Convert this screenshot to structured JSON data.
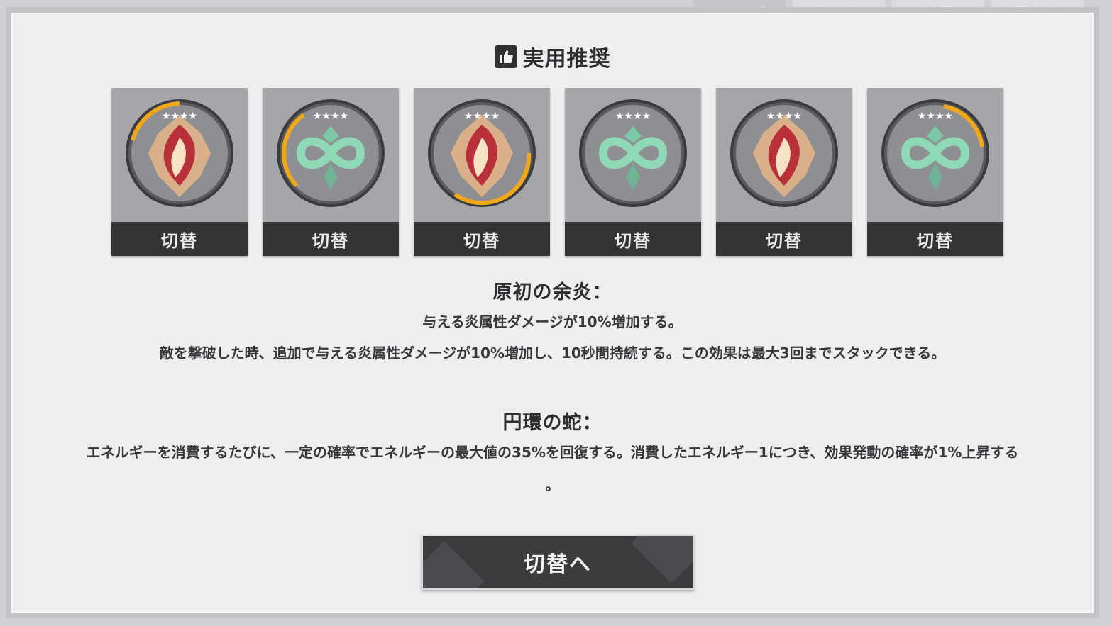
{
  "background": {
    "tabs": [
      "スロット",
      "セット",
      "効果",
      "戦力値"
    ]
  },
  "header": {
    "icon": "thumbs-up-icon",
    "title": "実用推奨"
  },
  "cards": [
    {
      "set": "fire",
      "emblem": "flame-emblem-icon",
      "button": "切替"
    },
    {
      "set": "serpent",
      "emblem": "serpent-infinity-emblem-icon",
      "button": "切替"
    },
    {
      "set": "fire",
      "emblem": "flame-emblem-icon",
      "button": "切替"
    },
    {
      "set": "serpent",
      "emblem": "serpent-infinity-emblem-icon",
      "button": "切替"
    },
    {
      "set": "fire",
      "emblem": "flame-emblem-icon",
      "button": "切替"
    },
    {
      "set": "serpent",
      "emblem": "serpent-infinity-emblem-icon",
      "button": "切替"
    }
  ],
  "sets": [
    {
      "name": "原初の余炎：",
      "lines": [
        "与える炎属性ダメージが10%増加する。",
        "敵を撃破した時、追加で与える炎属性ダメージが10%増加し、10秒間持続する。この効果は最大3回までスタックできる。"
      ]
    },
    {
      "name": "円環の蛇：",
      "lines": [
        "エネルギーを消費するたびに、一定の確率でエネルギーの最大値の35%を回復する。消費したエネルギー1につき、効果発動の確率が1%上昇する",
        "。"
      ]
    }
  ],
  "switch_button": "切替へ",
  "colors": {
    "fire_primary": "#b8313a",
    "serpent_primary": "#8fd9b6",
    "ring_accent": "#f0a818",
    "card_bg": "#a4a6aa",
    "button_bg": "#333436"
  }
}
